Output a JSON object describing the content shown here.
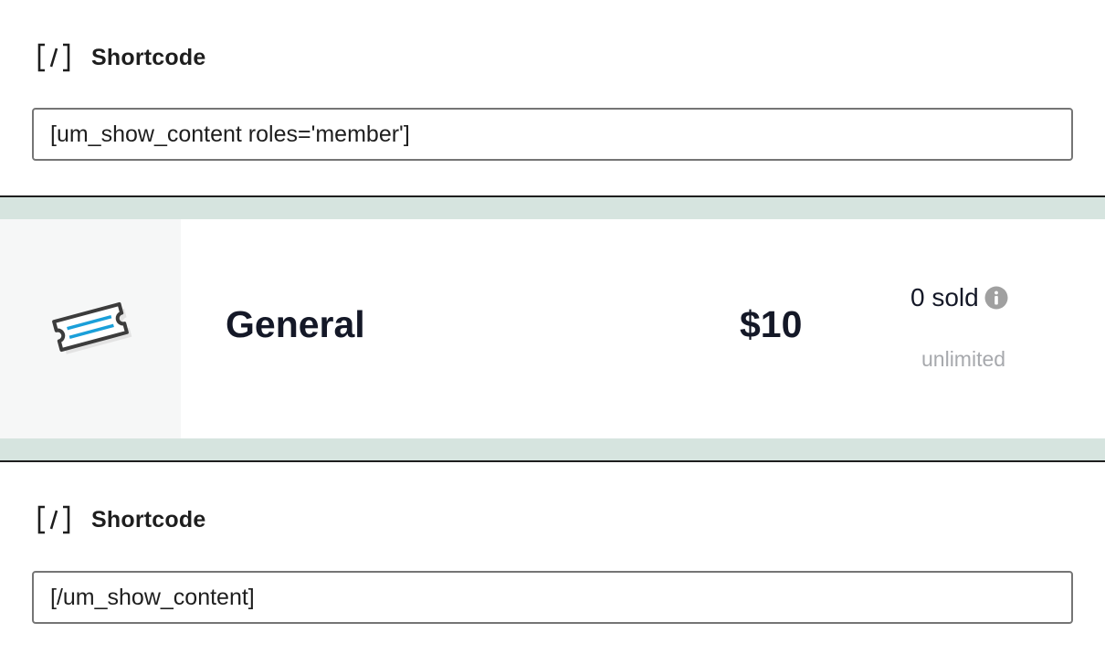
{
  "blocks": [
    {
      "icon": "shortcode-icon",
      "label": "Shortcode",
      "value": "[um_show_content roles='member']"
    },
    {
      "icon": "shortcode-icon",
      "label": "Shortcode",
      "value": "[/um_show_content]"
    }
  ],
  "ticket": {
    "icon": "ticket-icon",
    "name": "General",
    "price": "$10",
    "sold": "0 sold",
    "capacity": "unlimited",
    "info_icon": "info-icon"
  },
  "colors": {
    "ticket_band": "#d6e4df",
    "ticket_icon_stroke": "#3c3c3c",
    "ticket_icon_accent": "#1a9fd9",
    "muted_text": "#a7a9ad"
  }
}
